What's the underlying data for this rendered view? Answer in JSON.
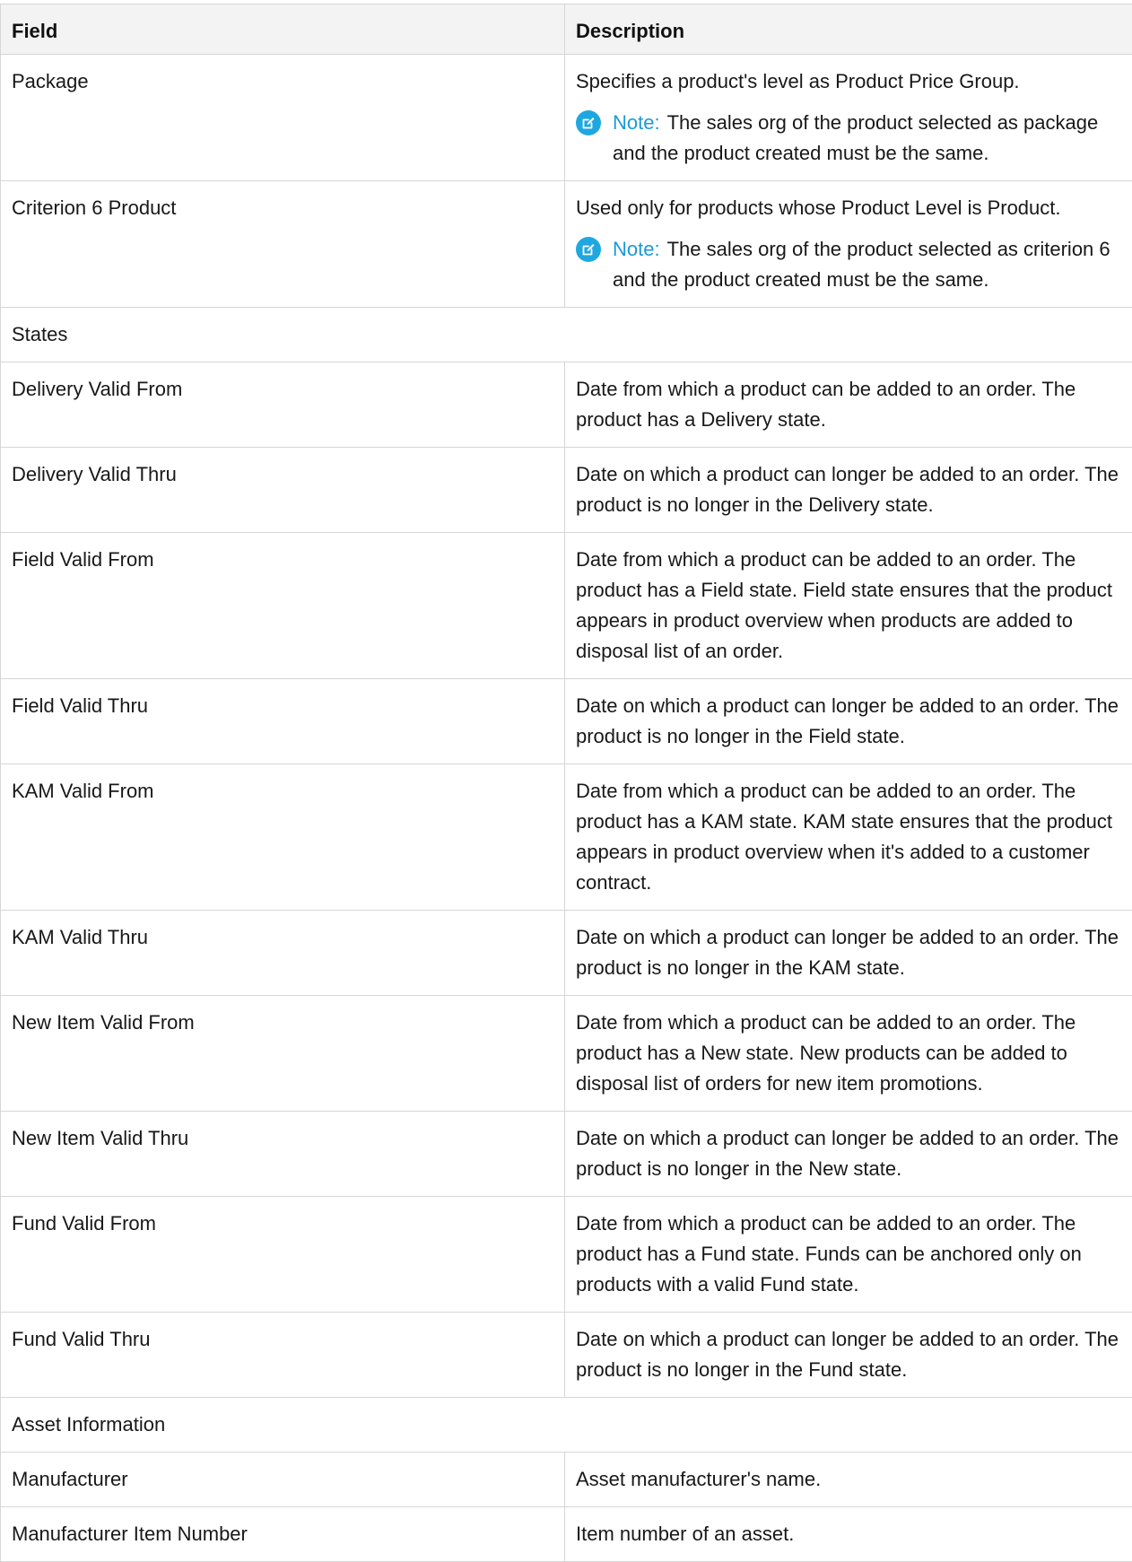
{
  "table": {
    "header": {
      "field": "Field",
      "description": "Description"
    },
    "rows": [
      {
        "field": "Package",
        "description": "Specifies a product's level as Product Price Group.",
        "note": {
          "label": "Note:",
          "text": "The sales org of the product selected as package and the product created must be the same."
        }
      },
      {
        "field": "Criterion 6 Product",
        "description": "Used only for products whose Product Level is Product.",
        "note": {
          "label": "Note:",
          "text": "The sales org of the product selected as criterion 6 and the product created must be the same."
        }
      },
      {
        "section": "States"
      },
      {
        "field": "Delivery Valid From",
        "description": "Date from which a product can be added to an order. The product has a Delivery state."
      },
      {
        "field": "Delivery Valid Thru",
        "description": "Date on which a product can longer be added to an order. The product is no longer in the Delivery state."
      },
      {
        "field": "Field Valid From",
        "description": "Date from which a product can be added to an order. The product has a Field state. Field state ensures that the product appears in product overview when products are added to disposal list of an order."
      },
      {
        "field": "Field Valid Thru",
        "description": "Date on which a product can longer be added to an order. The product is no longer in the Field state."
      },
      {
        "field": "KAM Valid From",
        "description": "Date from which a product can be added to an order. The product has a KAM state. KAM state ensures that the product appears in product overview when it's added to a customer contract."
      },
      {
        "field": "KAM Valid Thru",
        "description": "Date on which a product can longer be added to an order. The product is no longer in the KAM state."
      },
      {
        "field": "New Item Valid From",
        "description": "Date from which a product can be added to an order. The product has a New state. New products can be added to disposal list of orders for new item promotions."
      },
      {
        "field": "New Item Valid Thru",
        "description": "Date on which a product can longer be added to an order. The product is no longer in the New state."
      },
      {
        "field": "Fund Valid From",
        "description": "Date from which a product can be added to an order. The product has a Fund state. Funds can be anchored only on products with a valid Fund state."
      },
      {
        "field": "Fund Valid Thru",
        "description": "Date on which a product can longer be added to an order. The product is no longer in the Fund state."
      },
      {
        "section": "Asset Information"
      },
      {
        "field": "Manufacturer",
        "description": "Asset manufacturer's name."
      },
      {
        "field": "Manufacturer Item Number",
        "description": "Item number of an asset."
      }
    ]
  },
  "colors": {
    "note_accent": "#1a9ad6",
    "note_icon_bg": "#1fa7e0",
    "border": "#d6d6d6",
    "header_bg": "#f3f3f3"
  },
  "icons": {
    "note": "edit-note-icon"
  }
}
